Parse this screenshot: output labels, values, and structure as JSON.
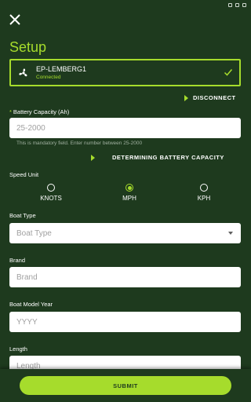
{
  "header": {
    "title": "Setup"
  },
  "device": {
    "name": "EP-LEMBERG1",
    "status": "Connected"
  },
  "actions": {
    "disconnect": "DISCONNECT",
    "determine_capacity": "DETERMINING BATTERY CAPACITY"
  },
  "battery": {
    "required_mark": "*",
    "label": "Battery Capacity (Ah)",
    "placeholder": "25-2000",
    "helper": "This is mandatory field. Enter number between 25-2000"
  },
  "speed_unit": {
    "label": "Speed Unit",
    "options": [
      {
        "label": "KNOTS",
        "selected": false
      },
      {
        "label": "MPH",
        "selected": true
      },
      {
        "label": "KPH",
        "selected": false
      }
    ]
  },
  "boat_type": {
    "label": "Boat Type",
    "placeholder": "Boat Type"
  },
  "brand": {
    "label": "Brand",
    "placeholder": "Brand"
  },
  "model_year": {
    "label": "Boat Model Year",
    "placeholder": "YYYY"
  },
  "length": {
    "label": "Length",
    "placeholder": "Length"
  },
  "submit": {
    "label": "SUBMIT"
  },
  "colors": {
    "background": "#1e3a1e",
    "accent": "#a6dc2c"
  },
  "icons": {
    "close": "close-icon",
    "fan": "fan-icon",
    "check": "check-icon",
    "caret": "chevron-down-icon"
  }
}
